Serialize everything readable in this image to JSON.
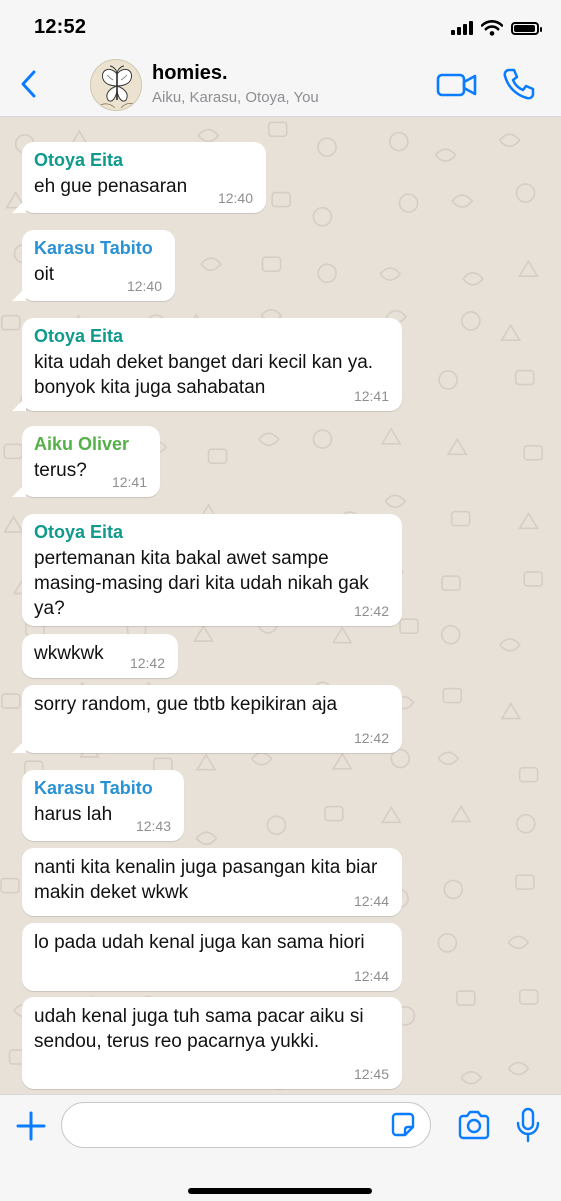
{
  "status": {
    "time": "12:52"
  },
  "header": {
    "title": "homies.",
    "subtitle": "Aiku, Karasu, Otoya, You"
  },
  "colors": {
    "accent": "#0a7cff",
    "otoya": "#0f9a8c",
    "karasu": "#2a92d4",
    "aiku": "#56b04a",
    "chat_bg": "#e8e1d8"
  },
  "messages": [
    {
      "sender": "Otoya Eita",
      "sender_key": "otoya",
      "text": "eh gue penasaran",
      "time": "12:40",
      "tail": true
    },
    {
      "sender": "Karasu Tabito",
      "sender_key": "karasu",
      "text": "oit",
      "time": "12:40",
      "tail": true
    },
    {
      "sender": "Otoya Eita",
      "sender_key": "otoya",
      "text": "kita udah deket banget dari kecil kan ya. bonyok kita juga sahabatan",
      "time": "12:41",
      "tail": true
    },
    {
      "sender": "Aiku Oliver",
      "sender_key": "aiku",
      "text": "terus?",
      "time": "12:41",
      "tail": true
    },
    {
      "sender": "Otoya Eita",
      "sender_key": "otoya",
      "text": "pertemanan kita bakal awet sampe masing-masing dari kita udah nikah gak ya?",
      "time": "12:42",
      "tail": false
    },
    {
      "sender": "",
      "sender_key": "otoya",
      "text": "wkwkwk",
      "time": "12:42",
      "tail": false
    },
    {
      "sender": "",
      "sender_key": "otoya",
      "text": "sorry random, gue tbtb kepikiran aja",
      "time": "12:42",
      "tail": true
    },
    {
      "sender": "Karasu Tabito",
      "sender_key": "karasu",
      "text": "harus lah",
      "time": "12:43",
      "tail": false
    },
    {
      "sender": "",
      "sender_key": "karasu",
      "text": "nanti kita kenalin juga pasangan kita biar makin deket wkwk",
      "time": "12:44",
      "tail": false
    },
    {
      "sender": "",
      "sender_key": "karasu",
      "text": "lo pada udah kenal juga kan sama hiori",
      "time": "12:44",
      "tail": false
    },
    {
      "sender": "",
      "sender_key": "karasu",
      "text": "udah kenal juga tuh sama pacar aiku si sendou, terus reo pacarnya yukki.",
      "time": "12:45",
      "tail": false
    }
  ],
  "composer": {
    "value": "",
    "placeholder": ""
  },
  "icons": {
    "back": "chevron-left-icon",
    "video": "video-camera-icon",
    "call": "phone-icon",
    "add": "plus-icon",
    "sticker": "sticker-icon",
    "camera": "camera-icon",
    "mic": "microphone-icon"
  }
}
